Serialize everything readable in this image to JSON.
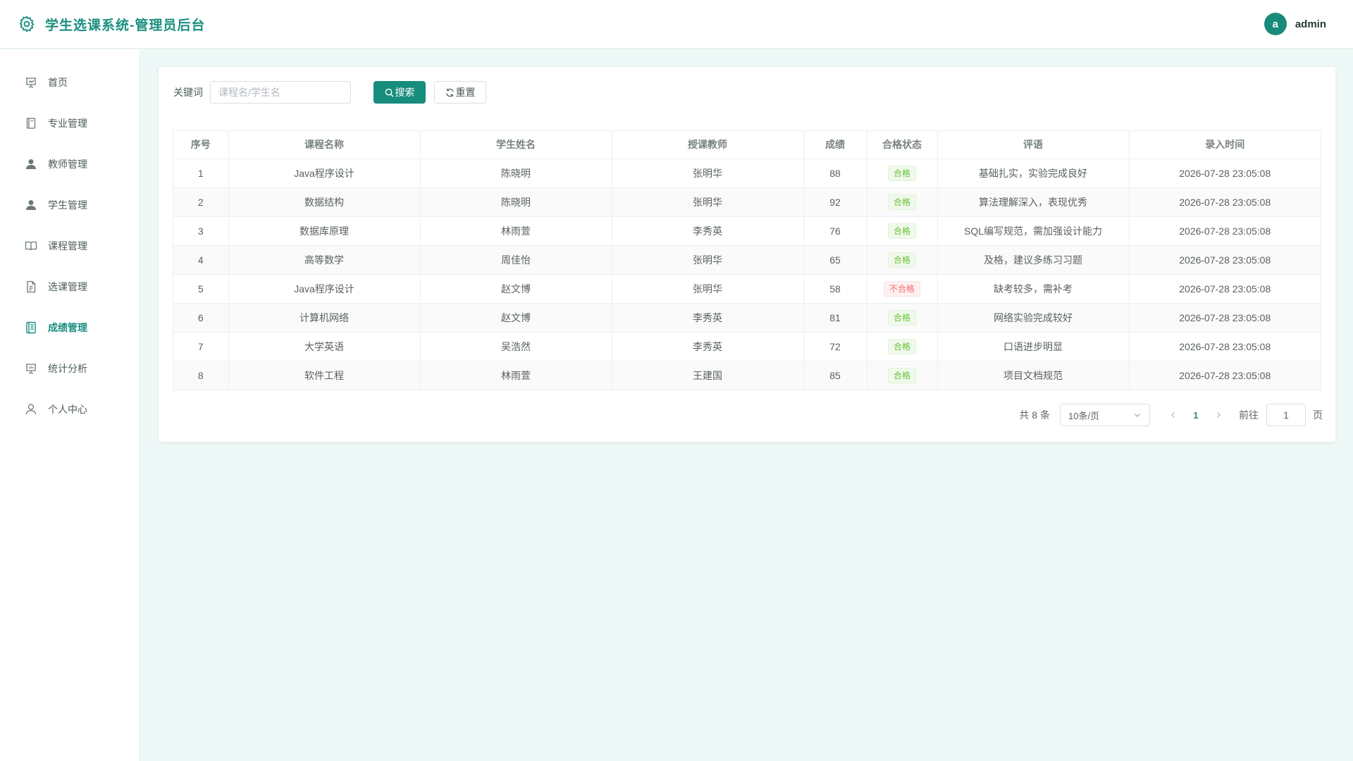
{
  "header": {
    "title": "学生选课系统-管理员后台",
    "avatar_letter": "a",
    "username": "admin"
  },
  "sidebar": {
    "items": [
      {
        "label": "首页",
        "icon": "presentation-icon",
        "active": false
      },
      {
        "label": "专业管理",
        "icon": "notebook-icon",
        "active": false
      },
      {
        "label": "教师管理",
        "icon": "user-filled-icon",
        "active": false
      },
      {
        "label": "学生管理",
        "icon": "user-filled-icon",
        "active": false
      },
      {
        "label": "课程管理",
        "icon": "open-book-icon",
        "active": false
      },
      {
        "label": "选课管理",
        "icon": "document-icon",
        "active": false
      },
      {
        "label": "成绩管理",
        "icon": "tickets-icon",
        "active": true
      },
      {
        "label": "统计分析",
        "icon": "data-board-icon",
        "active": false
      },
      {
        "label": "个人中心",
        "icon": "user-outline-icon",
        "active": false
      }
    ]
  },
  "filter": {
    "label": "关键词",
    "placeholder": "课程名/学生名",
    "search_label": "搜索",
    "reset_label": "重置"
  },
  "table": {
    "columns": [
      "序号",
      "课程名称",
      "学生姓名",
      "授课教师",
      "成绩",
      "合格状态",
      "评语",
      "录入时间"
    ],
    "rows": [
      {
        "no": "1",
        "course": "Java程序设计",
        "student": "陈晓明",
        "teacher": "张明华",
        "score": "88",
        "status": "合格",
        "pass": true,
        "comment": "基础扎实，实验完成良好",
        "time": "2026-07-28 23:05:08"
      },
      {
        "no": "2",
        "course": "数据结构",
        "student": "陈晓明",
        "teacher": "张明华",
        "score": "92",
        "status": "合格",
        "pass": true,
        "comment": "算法理解深入，表现优秀",
        "time": "2026-07-28 23:05:08"
      },
      {
        "no": "3",
        "course": "数据库原理",
        "student": "林雨萱",
        "teacher": "李秀英",
        "score": "76",
        "status": "合格",
        "pass": true,
        "comment": "SQL编写规范，需加强设计能力",
        "time": "2026-07-28 23:05:08"
      },
      {
        "no": "4",
        "course": "高等数学",
        "student": "周佳怡",
        "teacher": "张明华",
        "score": "65",
        "status": "合格",
        "pass": true,
        "comment": "及格，建议多练习习题",
        "time": "2026-07-28 23:05:08"
      },
      {
        "no": "5",
        "course": "Java程序设计",
        "student": "赵文博",
        "teacher": "张明华",
        "score": "58",
        "status": "不合格",
        "pass": false,
        "comment": "缺考较多，需补考",
        "time": "2026-07-28 23:05:08"
      },
      {
        "no": "6",
        "course": "计算机网络",
        "student": "赵文博",
        "teacher": "李秀英",
        "score": "81",
        "status": "合格",
        "pass": true,
        "comment": "网络实验完成较好",
        "time": "2026-07-28 23:05:08"
      },
      {
        "no": "7",
        "course": "大学英语",
        "student": "吴浩然",
        "teacher": "李秀英",
        "score": "72",
        "status": "合格",
        "pass": true,
        "comment": "口语进步明显",
        "time": "2026-07-28 23:05:08"
      },
      {
        "no": "8",
        "course": "软件工程",
        "student": "林雨萱",
        "teacher": "王建国",
        "score": "85",
        "status": "合格",
        "pass": true,
        "comment": "项目文档规范",
        "time": "2026-07-28 23:05:08"
      }
    ]
  },
  "pagination": {
    "total_text": "共 8 条",
    "page_size": "10条/页",
    "current_page": "1",
    "goto_label": "前往",
    "goto_value": "1",
    "goto_suffix": "页"
  },
  "colors": {
    "brand": "#1a8f80",
    "pass": "#67c23a",
    "fail": "#f56c6c",
    "background": "#eef9f7"
  }
}
